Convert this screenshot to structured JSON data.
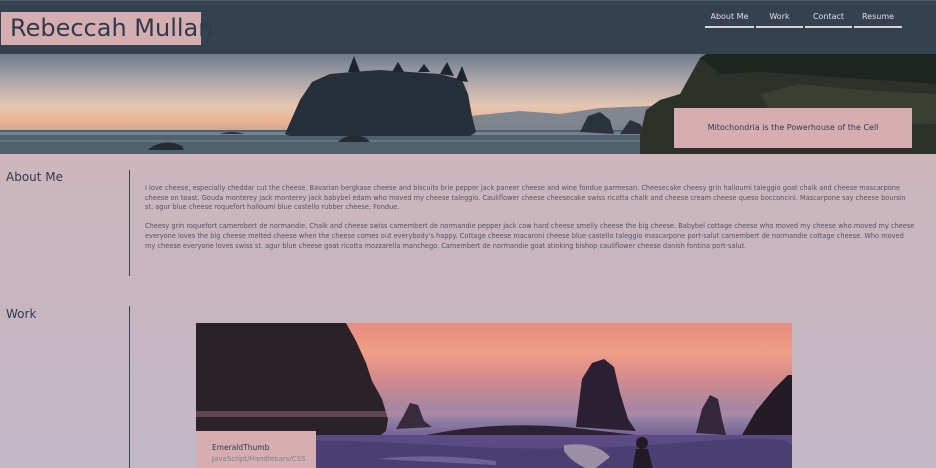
{
  "header": {
    "brand": "Rebeccah Mullan",
    "nav": [
      {
        "label": "About Me"
      },
      {
        "label": "Work"
      },
      {
        "label": "Contact"
      },
      {
        "label": "Resume"
      }
    ]
  },
  "hero": {
    "tagline": "Mitochondria is the Powerhouse of the Cell"
  },
  "about": {
    "title": "About Me",
    "paragraphs": [
      "I love cheese, especially cheddar cut the cheese. Bavarian bergkase cheese and biscuits brie pepper jack paneer cheese and wine fondue parmesan. Cheesecake cheesy grin halloumi taleggio goat chalk and cheese mascarpone cheese on toast. Gouda monterey jack monterey jack babybel edam who moved my cheese taleggio. Cauliflower cheese cheesecake swiss ricotta chalk and cheese cream cheese queso bocconcini. Mascarpone say cheese boursin st. agur blue cheese roquefort halloumi blue castello rubber cheese. Fondue.",
      "Cheesy grin roquefort camembert de normandie. Chalk and cheese swiss camembert de normandie pepper jack cow hard cheese smelly cheese the big cheese. Babybel cottage cheese who moved my cheese who moved my cheese everyone loves the big cheese melted cheese when the cheese comes out everybody's happy. Cottage cheese macaroni cheese blue castello taleggio mascarpone port-salut camembert de normandie cottage cheese. Who moved my cheese everyone loves swiss st. agur blue cheese goat ricotta mozzarella manchego. Camembert de normandie goat stinking bishop cauliflower cheese danish fontina port-salut."
    ]
  },
  "work": {
    "title": "Work",
    "projects": [
      {
        "name": "EmeraldThumb",
        "tech": "JavaScript/Handlebars/CSS"
      }
    ]
  },
  "colors": {
    "header_bg": "#334150",
    "accent_pink": "#d6aeb1",
    "text_dark": "#2f3b4b"
  }
}
